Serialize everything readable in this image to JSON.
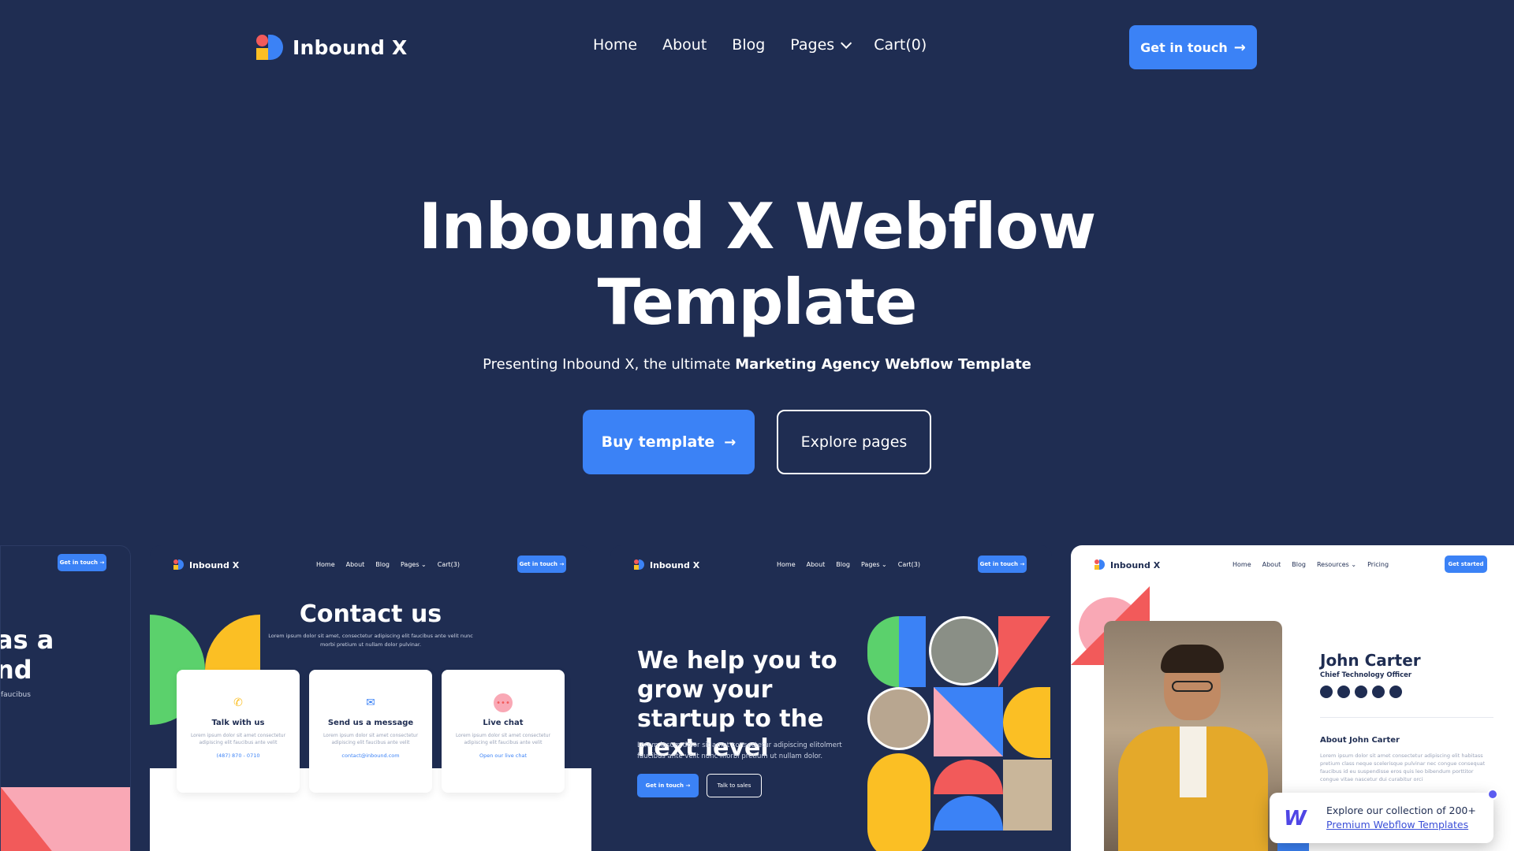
{
  "colors": {
    "background": "#1f2d52",
    "accent": "#3b82f6",
    "red": "#f25a5a",
    "yellow": "#fbbf24",
    "green": "#5bd16c",
    "pink": "#f9a8b5",
    "white": "#ffffff"
  },
  "nav": {
    "brand": "Inbound X",
    "items": [
      {
        "label": "Home"
      },
      {
        "label": "About"
      },
      {
        "label": "Blog"
      },
      {
        "label": "Pages"
      },
      {
        "label": "Cart(0)"
      }
    ],
    "cta_label": "Get in touch"
  },
  "hero": {
    "title_line1": "Inbound X Webflow",
    "title_line2": "Template",
    "subtitle_prefix": "Presenting Inbound X, the ultimate ",
    "subtitle_bold": "Marketing Agency Webflow Template",
    "primary_button": "Buy template",
    "secondary_button": "Explore pages"
  },
  "previews": {
    "partial": {
      "cta": "Get in touch →",
      "line1": "as a",
      "line2": "nd",
      "small": "faucibus"
    },
    "contact": {
      "brand": "Inbound X",
      "menu": [
        "Home",
        "About",
        "Blog",
        "Pages ⌄",
        "Cart(3)"
      ],
      "cta": "Get in touch →",
      "title": "Contact us",
      "lorem": "Lorem ipsum dolor sit amet, consectetur adipiscing elit faucibus ante velit nunc morbi pretium ut nullam dolor pulvinar.",
      "cards": [
        {
          "heading": "Talk with us",
          "body": "Lorem ipsum dolor sit amet consectetur adipiscing elit faucibus ante velit",
          "link": "(487) 870 - 0710"
        },
        {
          "heading": "Send us a message",
          "body": "Lorem ipsum dolor sit amet consectetur adipiscing elit faucibus ante velit",
          "link": "contact@inbound.com"
        },
        {
          "heading": "Live chat",
          "body": "Lorem ipsum dolor sit amet consectetur adipiscing elit faucibus ante velit",
          "link": "Open our live chat"
        }
      ]
    },
    "startup": {
      "brand": "Inbound X",
      "menu": [
        "Home",
        "About",
        "Blog",
        "Pages ⌄",
        "Cart(3)"
      ],
      "cta": "Get in touch →",
      "headline": "We help you to grow your startup to the next level",
      "body": "Lorem ipsum dolor sit amet consectetur adipiscing elitolmert faucibus ante velit nunc morbi pretium ut nullam dolor.",
      "button_primary": "Get in touch →",
      "button_secondary": "Talk to sales"
    },
    "profile": {
      "brand": "Inbound X",
      "menu": [
        "Home",
        "About",
        "Blog",
        "Resources ⌄",
        "Pricing"
      ],
      "cta": "Get started",
      "name": "John Carter",
      "role": "Chief Technology Officer",
      "about_heading": "About John Carter",
      "about_body": "Lorem ipsum dolor sit amet consectetur adipiscing elit habitass pretium class neque scelerisque pulvinar nec congue consequat faucibus id eu suspendisse eros quis leo bibendum porttitor congue vitae nascetur dui curabitur orci"
    }
  },
  "promo": {
    "text": "Explore our collection of 200+",
    "link": "Premium Webflow Templates"
  }
}
